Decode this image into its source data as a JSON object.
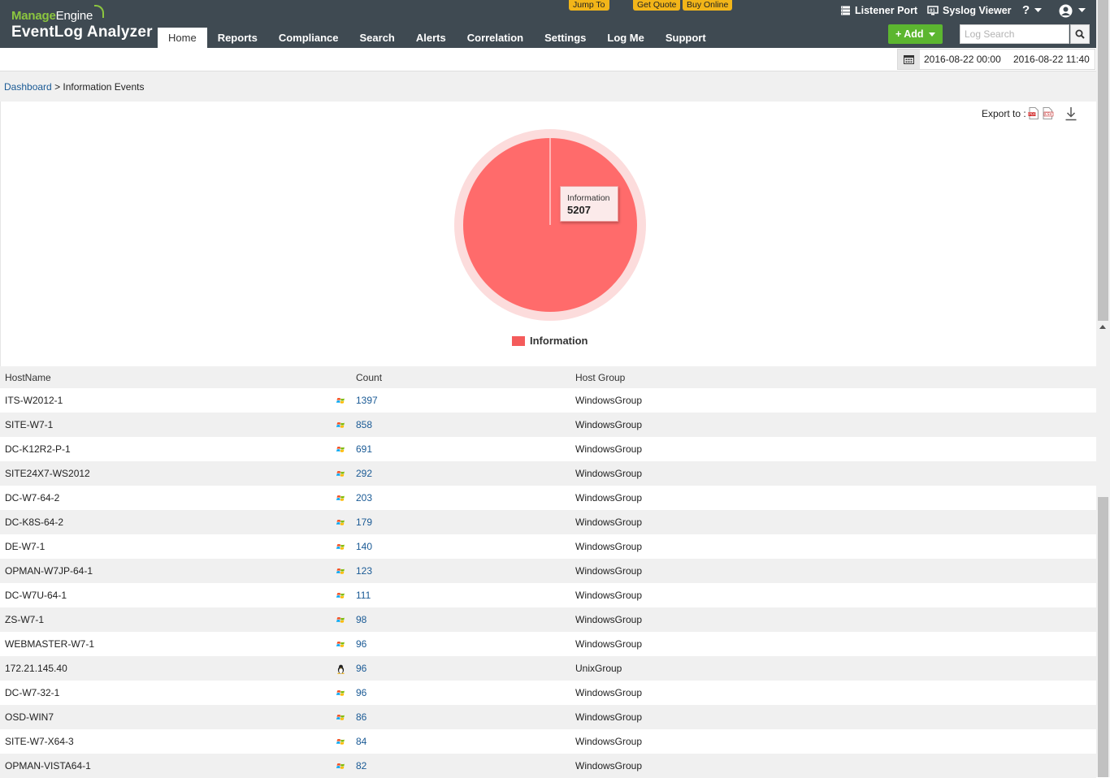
{
  "header": {
    "logo_brand": "Manage",
    "logo_brand_suffix": "Engine",
    "logo_product": "EventLog Analyzer",
    "promo": {
      "jump_to": "Jump To",
      "get_quote": "Get Quote",
      "buy_online": "Buy Online"
    },
    "tools": {
      "listener_port": "Listener Port",
      "syslog_viewer": "Syslog Viewer",
      "help": "?"
    },
    "add_button": "+ Add",
    "search_placeholder": "Log Search",
    "nav": [
      {
        "label": "Home",
        "active": true
      },
      {
        "label": "Reports"
      },
      {
        "label": "Compliance"
      },
      {
        "label": "Search"
      },
      {
        "label": "Alerts"
      },
      {
        "label": "Correlation"
      },
      {
        "label": "Settings"
      },
      {
        "label": "Log Me"
      },
      {
        "label": "Support"
      }
    ]
  },
  "date_range": {
    "from": "2016-08-22 00:00",
    "to": "2016-08-22 11:40"
  },
  "breadcrumb": {
    "parent": "Dashboard",
    "separator": ">",
    "current": "Information Events"
  },
  "export": {
    "label": "Export to :"
  },
  "chart_data": {
    "type": "pie",
    "categories": [
      "Information"
    ],
    "values": [
      5207
    ],
    "colors": [
      "#f45b5b"
    ],
    "legend": "bottom",
    "tooltip": {
      "label": "Information",
      "value": "5207"
    }
  },
  "table": {
    "columns": [
      "HostName",
      "Count",
      "Host Group"
    ],
    "rows": [
      {
        "host": "ITS-W2012-1",
        "os": "windows",
        "count": "1397",
        "group": "WindowsGroup"
      },
      {
        "host": "SITE-W7-1",
        "os": "windows",
        "count": "858",
        "group": "WindowsGroup"
      },
      {
        "host": "DC-K12R2-P-1",
        "os": "windows",
        "count": "691",
        "group": "WindowsGroup"
      },
      {
        "host": "SITE24X7-WS2012",
        "os": "windows",
        "count": "292",
        "group": "WindowsGroup"
      },
      {
        "host": "DC-W7-64-2",
        "os": "windows",
        "count": "203",
        "group": "WindowsGroup"
      },
      {
        "host": "DC-K8S-64-2",
        "os": "windows",
        "count": "179",
        "group": "WindowsGroup"
      },
      {
        "host": "DE-W7-1",
        "os": "windows",
        "count": "140",
        "group": "WindowsGroup"
      },
      {
        "host": "OPMAN-W7JP-64-1",
        "os": "windows",
        "count": "123",
        "group": "WindowsGroup"
      },
      {
        "host": "DC-W7U-64-1",
        "os": "windows",
        "count": "111",
        "group": "WindowsGroup"
      },
      {
        "host": "ZS-W7-1",
        "os": "windows",
        "count": "98",
        "group": "WindowsGroup"
      },
      {
        "host": "WEBMASTER-W7-1",
        "os": "windows",
        "count": "96",
        "group": "WindowsGroup"
      },
      {
        "host": "172.21.145.40",
        "os": "linux",
        "count": "96",
        "group": "UnixGroup"
      },
      {
        "host": "DC-W7-32-1",
        "os": "windows",
        "count": "96",
        "group": "WindowsGroup"
      },
      {
        "host": "OSD-WIN7",
        "os": "windows",
        "count": "86",
        "group": "WindowsGroup"
      },
      {
        "host": "SITE-W7-X64-3",
        "os": "windows",
        "count": "84",
        "group": "WindowsGroup"
      },
      {
        "host": "OPMAN-VISTA64-1",
        "os": "windows",
        "count": "82",
        "group": "WindowsGroup"
      }
    ]
  }
}
